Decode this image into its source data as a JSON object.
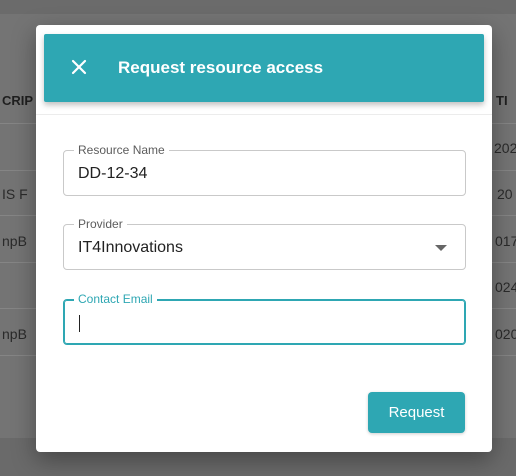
{
  "background": {
    "column_header_left": "CRIP",
    "column_header_right": "TI",
    "rows": [
      {
        "left": "",
        "right": "202"
      },
      {
        "left": "IS F",
        "right": "20"
      },
      {
        "left": "npB",
        "right": "017"
      },
      {
        "left": "",
        "right": "024"
      },
      {
        "left": "npB",
        "right": "020"
      }
    ]
  },
  "dialog": {
    "title": "Request resource access",
    "close_icon": "close-icon",
    "fields": {
      "resource_name": {
        "label": "Resource Name",
        "value": "DD-12-34"
      },
      "provider": {
        "label": "Provider",
        "value": "IT4Innovations"
      },
      "contact_email": {
        "label": "Contact Email",
        "value": ""
      }
    },
    "submit_label": "Request"
  },
  "colors": {
    "accent": "#2ea7b3",
    "overlay": "#747474"
  }
}
